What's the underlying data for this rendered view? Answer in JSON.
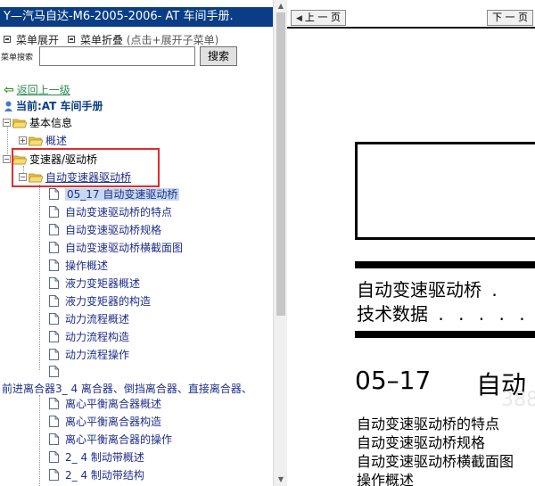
{
  "left_pane": {
    "title": "Y—汽马自达-M6-2005-2006- AT 车间手册.",
    "menu_expand": "菜单展开",
    "menu_collapse": "菜单折叠",
    "menu_hint": "(点击+展开子菜单)",
    "search_label": "菜单搜索",
    "search_value": "",
    "search_button": "搜索",
    "back_link": "返回上一级",
    "current_label": "当前:AT 车间手册",
    "tree": [
      {
        "label": "基本信息",
        "kind": "folder",
        "toggle": "−"
      },
      {
        "label": "概述",
        "kind": "folder",
        "toggle": "+"
      },
      {
        "label": "变速器/驱动桥",
        "kind": "folder",
        "toggle": "−"
      },
      {
        "label": "自动变速器驱动桥",
        "kind": "folder",
        "toggle": "−"
      },
      {
        "label": "05_17 自动变速驱动桥",
        "kind": "page",
        "selected": true
      },
      {
        "label": "自动变速驱动桥的特点",
        "kind": "page"
      },
      {
        "label": "自动变速驱动桥规格",
        "kind": "page"
      },
      {
        "label": "自动变速驱动桥横截面图",
        "kind": "page"
      },
      {
        "label": "操作概述",
        "kind": "page"
      },
      {
        "label": "液力变矩器概述",
        "kind": "page"
      },
      {
        "label": "液力变矩器的构造",
        "kind": "page"
      },
      {
        "label": "动力流程概述",
        "kind": "page"
      },
      {
        "label": "动力流程构造",
        "kind": "page"
      },
      {
        "label": "动力流程操作",
        "kind": "page"
      },
      {
        "label": "",
        "kind": "page"
      },
      {
        "label": "前进离合器3_ 4 离合器、倒挡离合器、直接离合器、",
        "kind": "text"
      },
      {
        "label": "离心平衡离合器概述",
        "kind": "page"
      },
      {
        "label": "离心平衡离合器构造",
        "kind": "page"
      },
      {
        "label": "离心平衡离合器的操作",
        "kind": "page"
      },
      {
        "label": "2_ 4 制动带概述",
        "kind": "page"
      },
      {
        "label": "2_ 4 制动带结构",
        "kind": "page"
      }
    ]
  },
  "right_pane": {
    "prev_button": "上 一 页",
    "next_button": "下 一 页",
    "heading_lines": [
      "自动变速驱动桥",
      "技术数据"
    ],
    "section_number": "05–17",
    "section_title": "自动",
    "toc_lines": [
      "自动变速驱动桥的特点",
      "自动变速驱动桥规格",
      "自动变速驱动桥横截面图",
      "操作概述"
    ],
    "watermark": "388"
  },
  "colors": {
    "title_bar": "#0a3d86",
    "selected_row": "#c7d9ef",
    "highlight_box": "#e22b2b",
    "back_link": "#2e8b57"
  }
}
